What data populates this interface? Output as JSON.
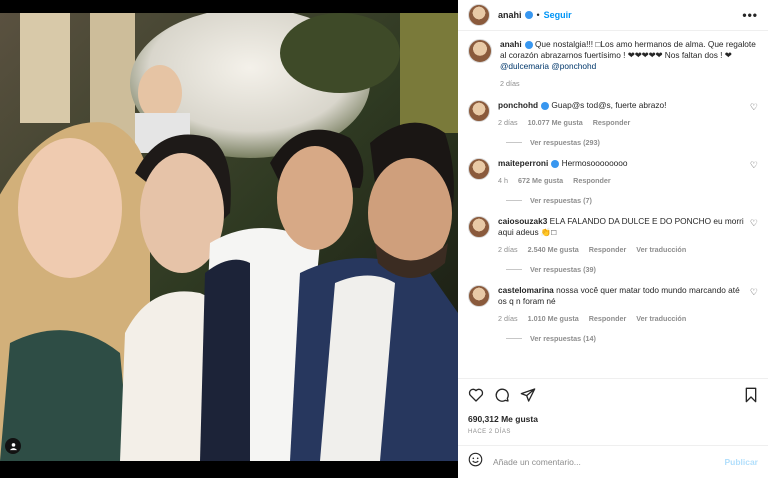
{
  "post": {
    "username": "anahi",
    "follow_label": "Seguir",
    "dot": "•",
    "caption": {
      "username": "anahi",
      "text": " Que nostalgia!!! □Los amo hermanos de alma. Que regalote al corazón abrazarnos fuertísimo ! ❤❤❤❤❤ Nos faltan dos ! ❤ ",
      "mention1": "@dulcemaria",
      "mention2": "@ponchohd",
      "age": "2 días"
    }
  },
  "comments": [
    {
      "username": "ponchohd",
      "verified": true,
      "text": " Guap@s tod@s, fuerte abrazo!",
      "age": "2 días",
      "likes": "10.077 Me gusta",
      "reply": "Responder",
      "translate": "",
      "replies": "Ver respuestas (293)"
    },
    {
      "username": "maiteperroni",
      "verified": true,
      "text": " Hermosoooooooo",
      "age": "4 h",
      "likes": "672 Me gusta",
      "reply": "Responder",
      "translate": "",
      "replies": "Ver respuestas (7)"
    },
    {
      "username": "caiosouzak3",
      "verified": false,
      "text": " ELA FALANDO DA DULCE E DO PONCHO eu morri aqui adeus 👏□",
      "age": "2 días",
      "likes": "2.540 Me gusta",
      "reply": "Responder",
      "translate": "Ver traducción",
      "replies": "Ver respuestas (39)"
    },
    {
      "username": "castelomarina",
      "verified": false,
      "text": " nossa você quer matar todo mundo marcando até os q n foram né",
      "age": "2 días",
      "likes": "1.010 Me gusta",
      "reply": "Responder",
      "translate": "Ver traducción",
      "replies": "Ver respuestas (14)"
    }
  ],
  "actions": {
    "likes": "690,312 Me gusta",
    "time": "HACE 2 DÍAS",
    "add_comment_placeholder": "Añade un comentario...",
    "publish_label": "Publicar"
  },
  "icons": [
    "more-options-icon",
    "heart-icon",
    "comment-icon",
    "share-icon",
    "bookmark-icon",
    "emoji-icon",
    "tag-user-icon"
  ],
  "colors": {
    "accent": "#0095f6",
    "verified": "#3897f0",
    "heart": "#ed4956",
    "publish_disabled": "#b2dffc"
  }
}
